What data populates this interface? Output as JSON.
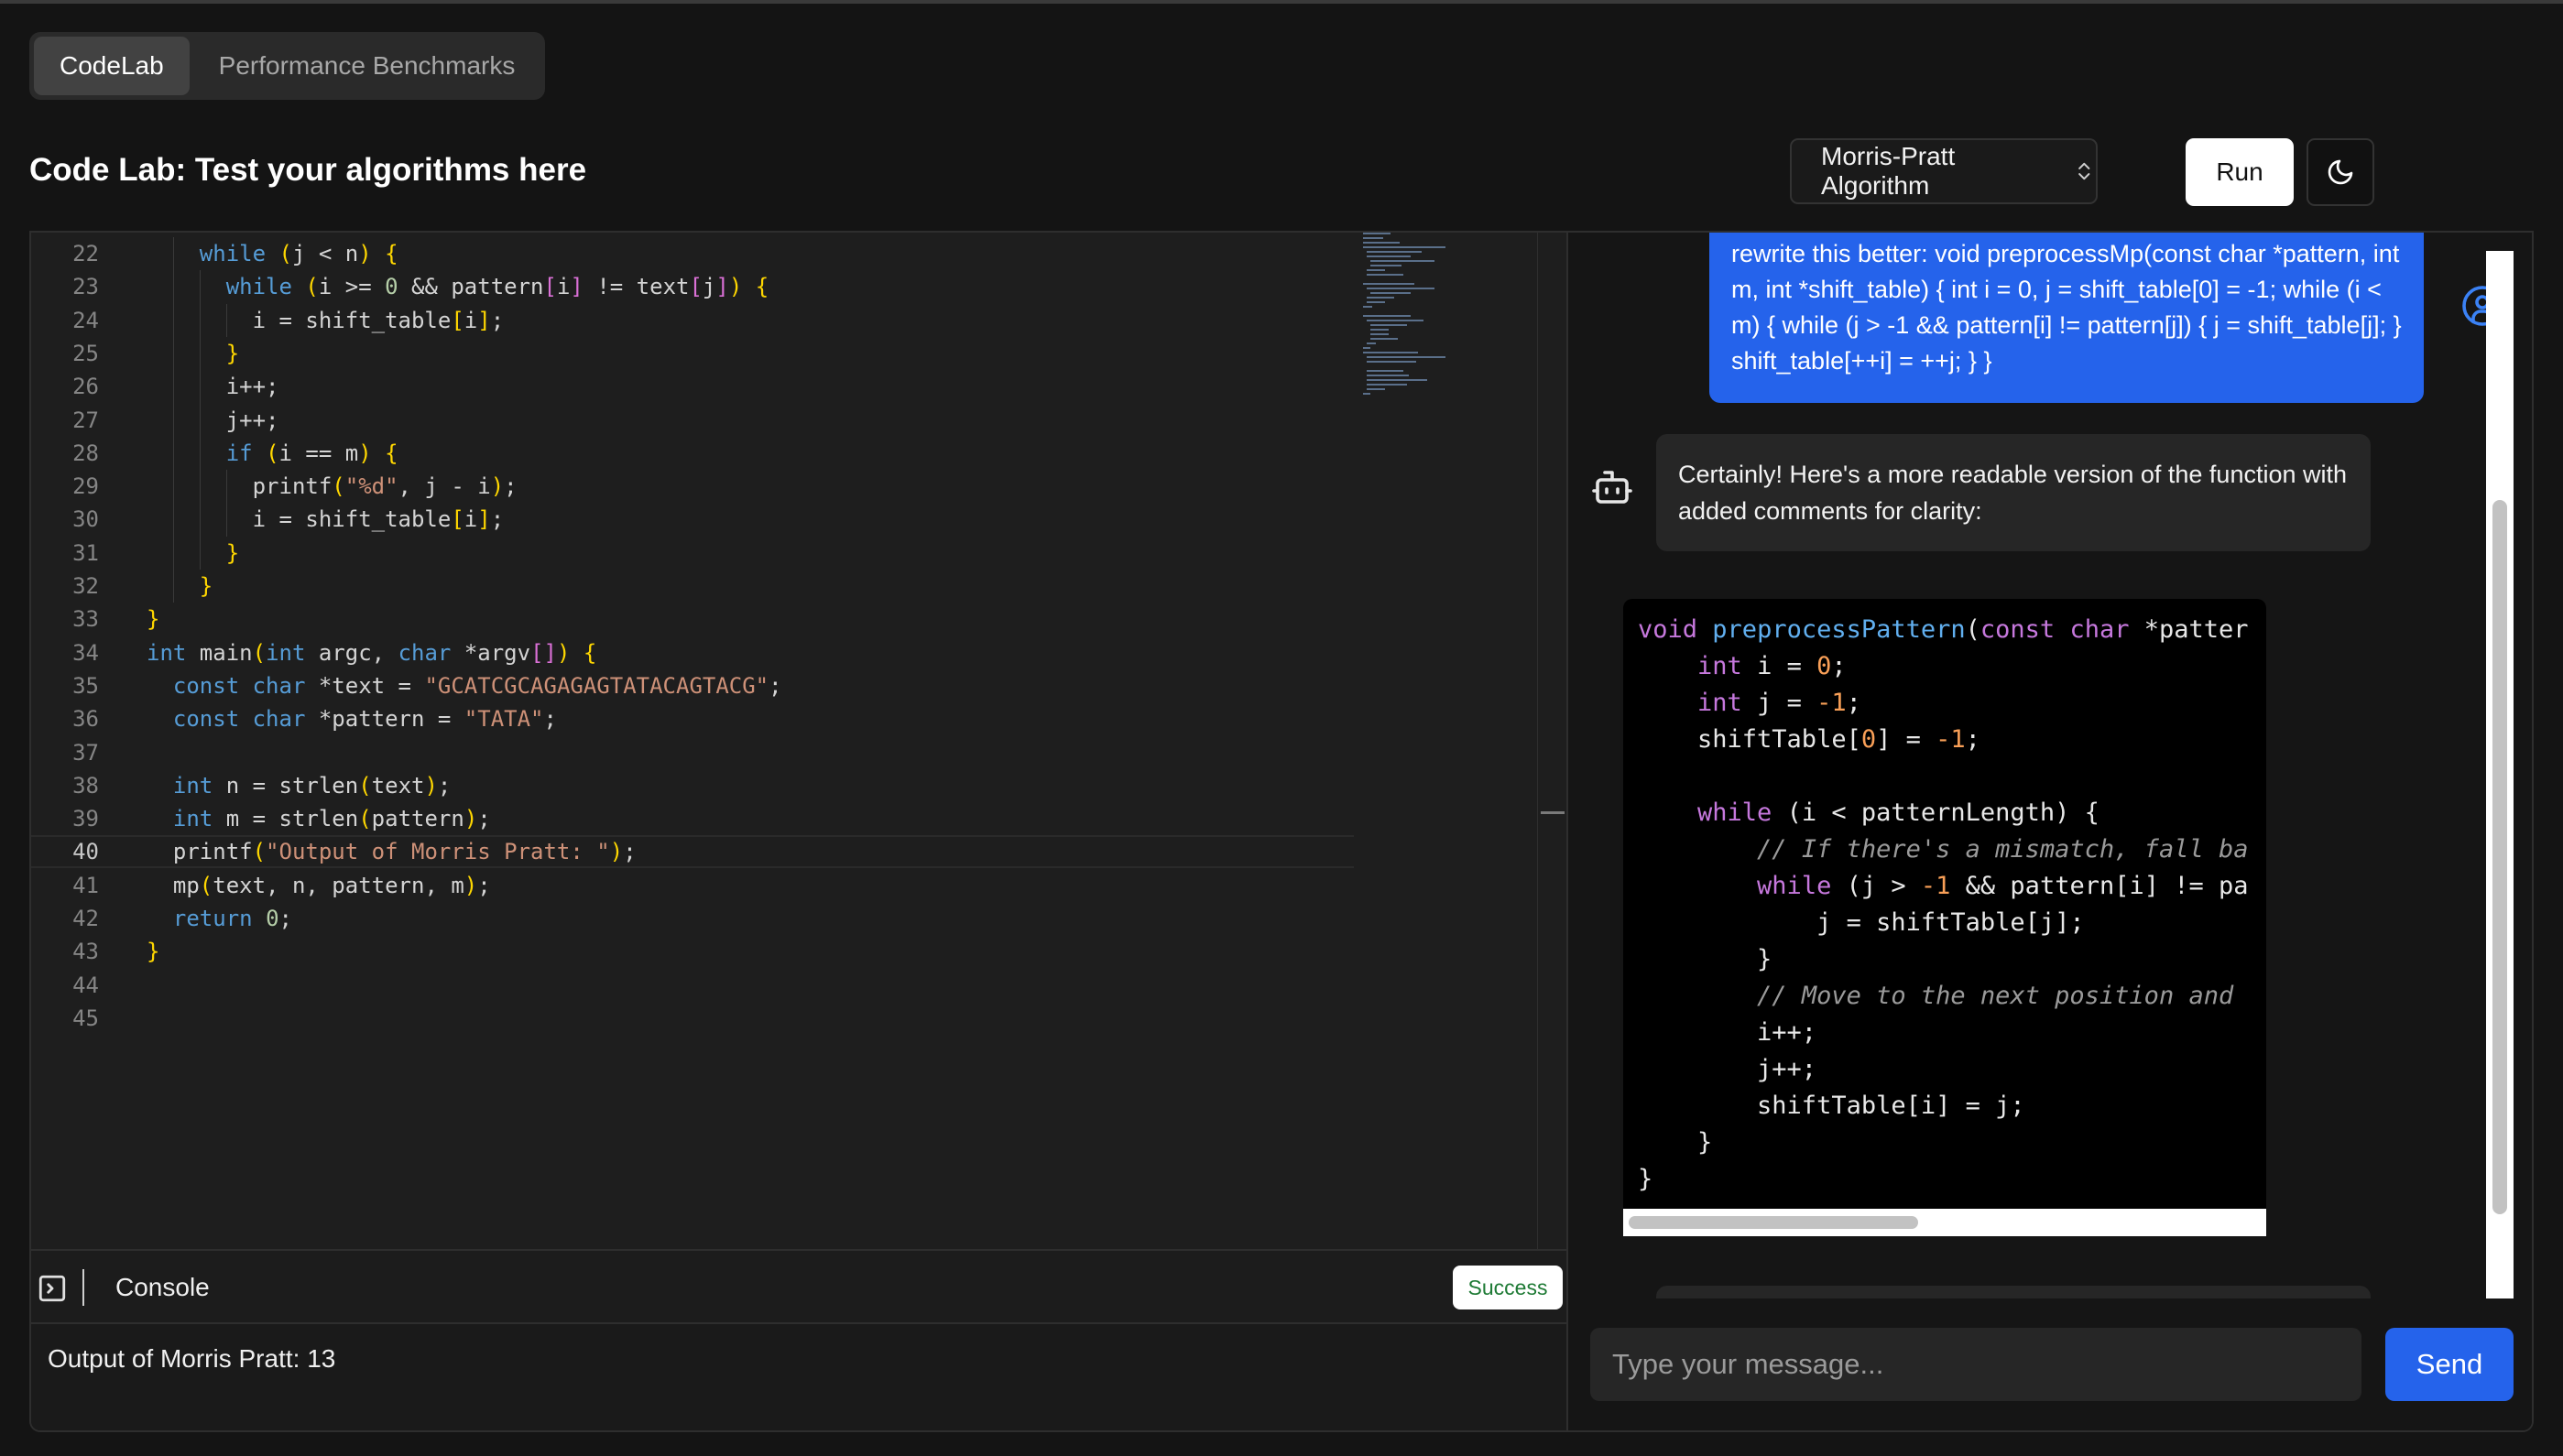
{
  "tabs": [
    {
      "label": "CodeLab",
      "active": true
    },
    {
      "label": "Performance Benchmarks",
      "active": false
    }
  ],
  "header": {
    "title": "Code Lab: Test your algorithms here",
    "algorithm_select": "Morris-Pratt Algorithm",
    "run_label": "Run",
    "theme_icon": "moon-icon"
  },
  "editor": {
    "current_line": 40,
    "lines": [
      {
        "n": 22,
        "text": "    while (j < n) {"
      },
      {
        "n": 23,
        "text": "      while (i >= 0 && pattern[i] != text[j]) {"
      },
      {
        "n": 24,
        "text": "        i = shift_table[i];"
      },
      {
        "n": 25,
        "text": "      }"
      },
      {
        "n": 26,
        "text": "      i++;"
      },
      {
        "n": 27,
        "text": "      j++;"
      },
      {
        "n": 28,
        "text": "      if (i == m) {"
      },
      {
        "n": 29,
        "text": "        printf(\"%d\", j - i);"
      },
      {
        "n": 30,
        "text": "        i = shift_table[i];"
      },
      {
        "n": 31,
        "text": "      }"
      },
      {
        "n": 32,
        "text": "    }"
      },
      {
        "n": 33,
        "text": "}"
      },
      {
        "n": 34,
        "text": "int main(int argc, char *argv[]) {"
      },
      {
        "n": 35,
        "text": "  const char *text = \"GCATCGCAGAGAGTATACAGTACG\";"
      },
      {
        "n": 36,
        "text": "  const char *pattern = \"TATA\";"
      },
      {
        "n": 37,
        "text": ""
      },
      {
        "n": 38,
        "text": "  int n = strlen(text);"
      },
      {
        "n": 39,
        "text": "  int m = strlen(pattern);"
      },
      {
        "n": 40,
        "text": "  printf(\"Output of Morris Pratt: \");"
      },
      {
        "n": 41,
        "text": "  mp(text, n, pattern, m);"
      },
      {
        "n": 42,
        "text": "  return 0;"
      },
      {
        "n": 43,
        "text": "}"
      },
      {
        "n": 44,
        "text": ""
      },
      {
        "n": 45,
        "text": ""
      }
    ]
  },
  "console": {
    "label": "Console",
    "status": "Success",
    "output": "Output of Morris Pratt: 13"
  },
  "chat": {
    "user_message": "rewrite this better: void preprocessMp(const char *pattern, int m, int *shift_table) { int i = 0, j = shift_table[0] = -1; while (i < m) { while (j > -1 && pattern[i] != pattern[j]) { j = shift_table[j]; } shift_table[++i] = ++j; } }",
    "bot_message": "Certainly! Here's a more readable version of the function with added comments for clarity:",
    "code_lines": [
      "void preprocessPattern(const char *patter",
      "    int i = 0;",
      "    int j = -1;",
      "    shiftTable[0] = -1;",
      "",
      "    while (i < patternLength) {",
      "        // If there's a mismatch, fall ba",
      "        while (j > -1 && pattern[i] != pa",
      "            j = shiftTable[j];",
      "        }",
      "        // Move to the next position and",
      "        i++;",
      "        j++;",
      "        shiftTable[i] = j;",
      "    }",
      "}"
    ],
    "input_placeholder": "Type your message...",
    "send_label": "Send"
  },
  "colors": {
    "accent": "#2563eb",
    "success": "#1e7a35",
    "background": "#141414"
  }
}
